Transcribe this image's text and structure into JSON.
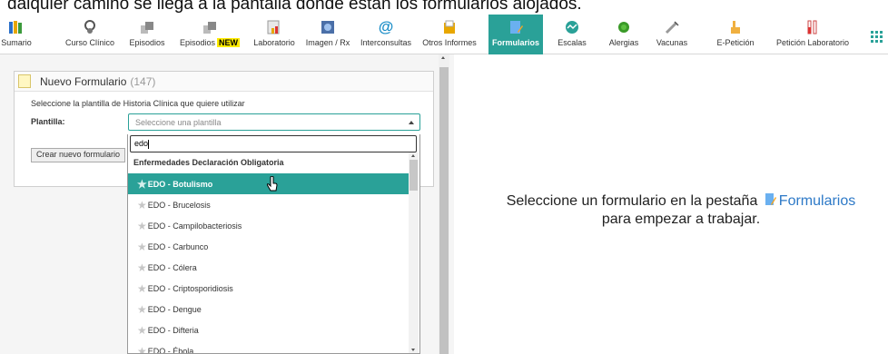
{
  "caption": "dalquier camino se llega a la pantalla donde están los formularios alojados.",
  "toolbar": {
    "items": [
      {
        "label": "Sumario",
        "icon": "books-icon"
      },
      {
        "label": "Curso Clínico",
        "icon": "stethoscope-icon"
      },
      {
        "label": "Episodios",
        "icon": "folders-icon"
      },
      {
        "label": "Episodios",
        "badge": "NEW",
        "icon": "folders-new-icon"
      },
      {
        "label": "Laboratorio",
        "icon": "lab-report-icon"
      },
      {
        "label": "Imagen / Rx",
        "icon": "xray-image-icon"
      },
      {
        "label": "Interconsultas",
        "icon": "at-sign-icon"
      },
      {
        "label": "Otros Informes",
        "icon": "documents-icon"
      },
      {
        "label": "Formularios",
        "icon": "form-pencil-icon",
        "active": true
      },
      {
        "label": "Escalas",
        "icon": "gauge-icon"
      },
      {
        "label": "Alergias",
        "icon": "allergen-icon"
      },
      {
        "label": "Vacunas",
        "icon": "syringe-icon"
      },
      {
        "label": "E-Petición",
        "icon": "hand-pointer-icon"
      },
      {
        "label": "Petición Laboratorio",
        "icon": "test-tubes-icon"
      },
      {
        "label": "",
        "icon": "apps-grid-icon"
      }
    ]
  },
  "panel": {
    "title": "Nuevo Formulario",
    "count": "(147)",
    "instruction": "Seleccione la plantilla de Historia Clínica que quiere utilizar",
    "field_label": "Plantilla:",
    "select_placeholder": "Seleccione una plantilla",
    "create_button": "Crear nuevo formulario"
  },
  "dropdown": {
    "search_value": "edo",
    "group_label": "Enfermedades Declaración Obligatoria",
    "options": [
      {
        "label": "EDO - Botulismo",
        "highlighted": true
      },
      {
        "label": "EDO - Brucelosis"
      },
      {
        "label": "EDO - Campilobacteriosis"
      },
      {
        "label": "EDO - Carbunco"
      },
      {
        "label": "EDO - Cólera"
      },
      {
        "label": "EDO - Criptosporidiosis"
      },
      {
        "label": "EDO - Dengue"
      },
      {
        "label": "EDO - Difteria"
      },
      {
        "label": "EDO - Ébola"
      }
    ]
  },
  "message": {
    "line1_prefix": "Seleccione un formulario en la pestaña",
    "link": "Formularios",
    "line2": "para empezar a trabajar."
  },
  "colors": {
    "accent": "#2aa198",
    "link": "#2d79c7",
    "badge": "#ffec00"
  }
}
